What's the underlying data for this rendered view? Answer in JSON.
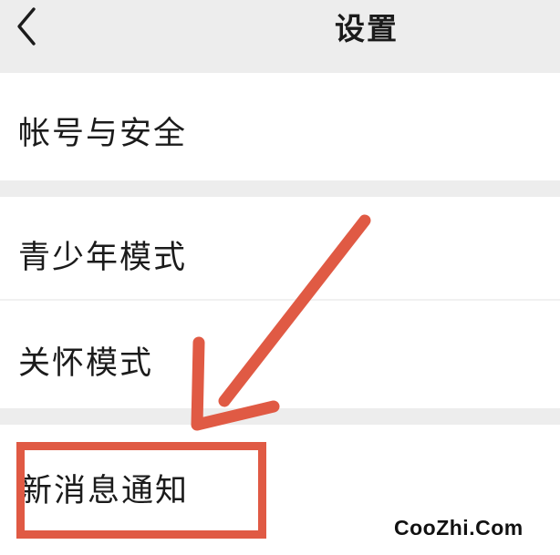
{
  "nav": {
    "title": "设置",
    "back_icon": "chevron-left-icon"
  },
  "groups": [
    {
      "items": [
        {
          "label": "帐号与安全"
        }
      ]
    },
    {
      "items": [
        {
          "label": "青少年模式"
        },
        {
          "label": "关怀模式"
        }
      ]
    },
    {
      "items": [
        {
          "label": "新消息通知"
        }
      ]
    }
  ],
  "annotation": {
    "color": "#e05a44"
  },
  "watermark": "CooZhi.Com"
}
